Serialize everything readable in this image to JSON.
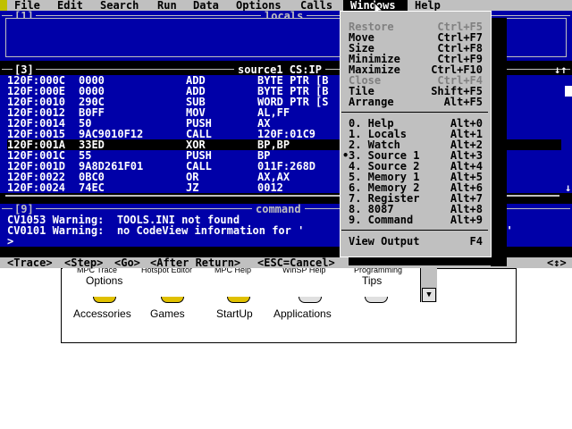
{
  "menubar": {
    "items": [
      "File",
      "Edit",
      "Search",
      "Run",
      "Data",
      "Options",
      "Calls",
      "Windows",
      "Help"
    ],
    "active": "Windows"
  },
  "locals_window": {
    "number": "[1]",
    "title": "locals"
  },
  "source_window": {
    "number": "[3]",
    "title": "source1 CS:IP",
    "rows": [
      {
        "addr": "120F:000C",
        "bytes": "0000",
        "mnem": "ADD",
        "ops": "BYTE PTR [B"
      },
      {
        "addr": "120F:000E",
        "bytes": "0000",
        "mnem": "ADD",
        "ops": "BYTE PTR [B"
      },
      {
        "addr": "120F:0010",
        "bytes": "290C",
        "mnem": "SUB",
        "ops": "WORD PTR [S"
      },
      {
        "addr": "120F:0012",
        "bytes": "B0FF",
        "mnem": "MOV",
        "ops": "AL,FF"
      },
      {
        "addr": "120F:0014",
        "bytes": "50",
        "mnem": "PUSH",
        "ops": "AX"
      },
      {
        "addr": "120F:0015",
        "bytes": "9AC9010F12",
        "mnem": "CALL",
        "ops": "120F:01C9"
      },
      {
        "addr": "120F:001A",
        "bytes": "33ED",
        "mnem": "XOR",
        "ops": "BP,BP"
      },
      {
        "addr": "120F:001C",
        "bytes": "55",
        "mnem": "PUSH",
        "ops": "BP"
      },
      {
        "addr": "120F:001D",
        "bytes": "9A8D261F01",
        "mnem": "CALL",
        "ops": "011F:268D"
      },
      {
        "addr": "120F:0022",
        "bytes": "0BC0",
        "mnem": "OR",
        "ops": "AX,AX"
      },
      {
        "addr": "120F:0024",
        "bytes": "74EC",
        "mnem": "JZ",
        "ops": "0012"
      }
    ],
    "selected_index": 6
  },
  "command_window": {
    "number": "[9]",
    "title": "command",
    "lines": [
      "CV1053 Warning:  TOOLS.INI not found",
      "CV0101 Warning:  no CodeView information for '"
    ],
    "line2_tail": "XE'",
    "prompt": ">"
  },
  "statusbar": {
    "items": [
      "<Trace>",
      "<Step>",
      "<Go>",
      "<After Return>",
      "<ESC=Cancel>"
    ],
    "right": "<↕>"
  },
  "windows_menu": {
    "group1": [
      {
        "label": "Restore",
        "accel": "Ctrl+F5",
        "disabled": true
      },
      {
        "label": "Move",
        "accel": "Ctrl+F7",
        "disabled": false
      },
      {
        "label": "Size",
        "accel": "Ctrl+F8",
        "disabled": false
      },
      {
        "label": "Minimize",
        "accel": "Ctrl+F9",
        "disabled": false
      },
      {
        "label": "Maximize",
        "accel": "Ctrl+F10",
        "disabled": false
      },
      {
        "label": "Close",
        "accel": "Ctrl+F4",
        "disabled": true
      },
      {
        "label": "Tile",
        "accel": "Shift+F5",
        "disabled": false
      },
      {
        "label": "Arrange",
        "accel": "Alt+F5",
        "disabled": false
      }
    ],
    "group2": [
      {
        "label": "0. Help",
        "accel": "Alt+0"
      },
      {
        "label": "1. Locals",
        "accel": "Alt+1"
      },
      {
        "label": "2. Watch",
        "accel": "Alt+2"
      },
      {
        "label": "3. Source 1",
        "accel": "Alt+3",
        "checked": true
      },
      {
        "label": "4. Source 2",
        "accel": "Alt+4"
      },
      {
        "label": "5. Memory 1",
        "accel": "Alt+5"
      },
      {
        "label": "6. Memory 2",
        "accel": "Alt+6"
      },
      {
        "label": "7. Register",
        "accel": "Alt+7"
      },
      {
        "label": "8. 8087",
        "accel": "Alt+8"
      },
      {
        "label": "9. Command",
        "accel": "Alt+9"
      }
    ],
    "group3": [
      {
        "label": "View Output",
        "accel": "F4"
      }
    ],
    "check_mark": "•"
  },
  "background_desktop": {
    "upper_labels": [
      "Options",
      "Tips"
    ],
    "partial_labels": [
      "MPC Trace",
      "Hotspot Editor",
      "MPC Help",
      "WinSP Help",
      "Programming"
    ],
    "group_labels": [
      "Accessories",
      "Games",
      "StartUp",
      "Applications"
    ]
  },
  "colors": {
    "window_blue": "#0000a8",
    "menu_gray": "#c0c0c0",
    "disabled_gray": "#808080"
  }
}
